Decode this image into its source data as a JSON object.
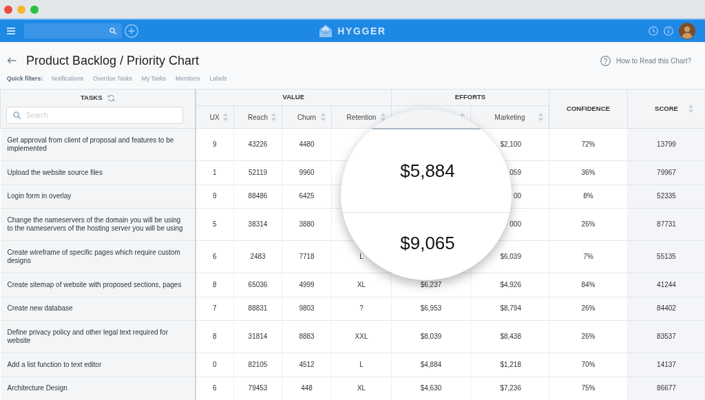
{
  "navbar": {
    "logo": "HYGGER"
  },
  "page": {
    "title": "Product Backlog / Priority Chart",
    "help_link": "How to Read this Chart?"
  },
  "quick_filters": {
    "label": "Quick filters:",
    "items": [
      "Notifications",
      "Overdue Tasks",
      "My Tasks",
      "Members",
      "Labels"
    ]
  },
  "table": {
    "tasks_header": "TASKS",
    "search_placeholder": "Search",
    "column_groups": [
      {
        "label": "VALUE",
        "columns": [
          {
            "label": "UX",
            "sortable": true
          },
          {
            "label": "Reach",
            "sortable": true
          },
          {
            "label": "Churn",
            "sortable": true
          },
          {
            "label": "Retention",
            "sortable": true
          }
        ]
      },
      {
        "label": "EFFORTS",
        "columns": [
          {
            "sortable": true
          },
          {
            "label": "Marketing",
            "sortable": true
          }
        ]
      },
      {
        "label": "CONFIDENCE",
        "sortable": false
      },
      {
        "label": "SCORE",
        "sortable": true
      }
    ],
    "rows": [
      {
        "task": "Get approval from client of proposal and features to be implemented",
        "cells": [
          "9",
          "43226",
          "4480",
          null,
          null,
          "$2,100",
          "72%",
          "13799"
        ]
      },
      {
        "task": "Upload the website source files",
        "cells": [
          "1",
          "52119",
          "9960",
          null,
          null,
          "059",
          "36%",
          "79967"
        ]
      },
      {
        "task": "Login form in overlay",
        "cells": [
          "9",
          "88486",
          "6425",
          null,
          null,
          "00",
          "8%",
          "52335"
        ]
      },
      {
        "task": "Change the nameservers of the domain you will be using to the nameservers of the hosting server you will be using",
        "cells": [
          "5",
          "38314",
          "3880",
          null,
          null,
          "000",
          "26%",
          "87731"
        ]
      },
      {
        "task": "Create wireframe of specific pages which require custom designs",
        "cells": [
          "6",
          "2483",
          "7718",
          "L",
          null,
          "$6,039",
          "7%",
          "55135"
        ]
      },
      {
        "task": "Create sitemap of website with proposed sections, pages",
        "cells": [
          "8",
          "65036",
          "4999",
          "XL",
          "$6,237",
          "$4,926",
          "84%",
          "41244"
        ]
      },
      {
        "task": "Create new database",
        "cells": [
          "7",
          "88831",
          "9803",
          "?",
          "$6,953",
          "$8,794",
          "26%",
          "84402"
        ]
      },
      {
        "task": "Define privacy policy and other legal text required for website",
        "cells": [
          "8",
          "31814",
          "8883",
          "XXL",
          "$8,039",
          "$8,438",
          "26%",
          "83537"
        ]
      },
      {
        "task": "Add a list function to text editor",
        "cells": [
          "0",
          "82105",
          "4512",
          "L",
          "$4,884",
          "$1,218",
          "70%",
          "14137"
        ]
      },
      {
        "task": "Architecture Design",
        "cells": [
          "6",
          "79453",
          "448",
          "XL",
          "$4,630",
          "$7,236",
          "75%",
          "86677"
        ]
      }
    ]
  },
  "magnifier": {
    "cells": [
      "$5,884",
      "$9,065"
    ]
  }
}
